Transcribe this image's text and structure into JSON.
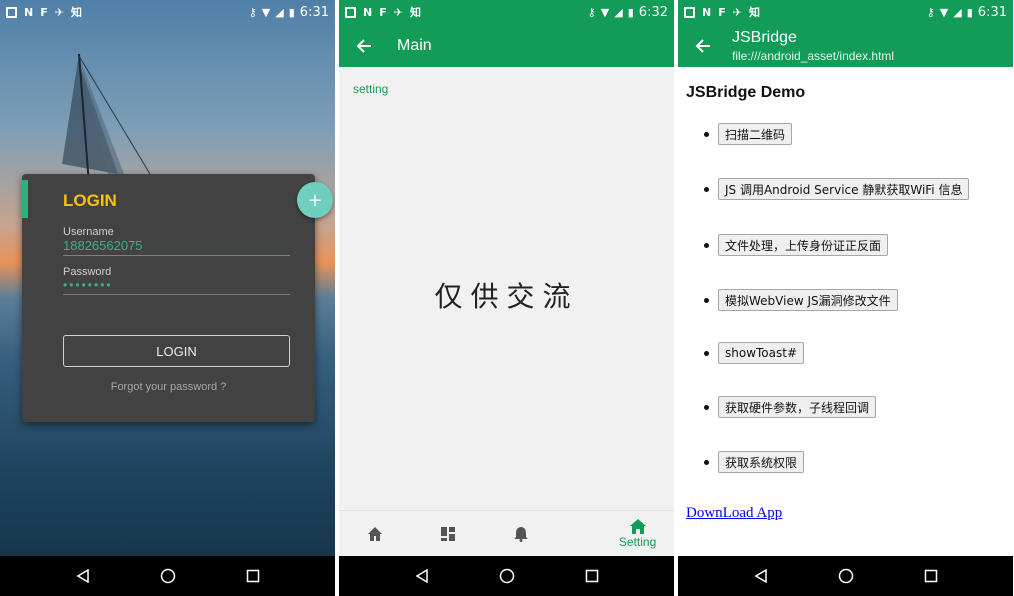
{
  "status_bars": [
    {
      "time": "6:31",
      "left_icons": [
        "notes-icon",
        "n-icon",
        "flipboard-icon",
        "twitter-icon"
      ],
      "zhi": "知"
    },
    {
      "time": "6:32",
      "left_icons": [
        "notes-icon",
        "n-icon",
        "flipboard-icon",
        "twitter-icon"
      ],
      "zhi": "知"
    },
    {
      "time": "6:31",
      "left_icons": [
        "notes-icon",
        "n-icon",
        "flipboard-icon",
        "twitter-icon"
      ],
      "zhi": "知"
    }
  ],
  "colors": {
    "brand_green": "#129c57",
    "login_yellow": "#f5c312",
    "accent_teal": "#2bb37e"
  },
  "login": {
    "title": "LOGIN",
    "username_label": "Username",
    "username_value": "18826562075",
    "password_label": "Password",
    "password_value": "••••••••",
    "button_label": "LOGIN",
    "forgot_text": "Forgot your password ?",
    "fab_icon": "plus-icon"
  },
  "main_screen": {
    "title": "Main",
    "setting_link": "setting",
    "center_text": "仅供交流",
    "tabs": [
      {
        "icon": "home-icon",
        "label": ""
      },
      {
        "icon": "dashboard-icon",
        "label": ""
      },
      {
        "icon": "bell-icon",
        "label": ""
      },
      {
        "icon": "home-icon",
        "label": "Setting",
        "active": true
      }
    ]
  },
  "jsbridge": {
    "title": "JSBridge",
    "subtitle": "file:///android_asset/index.html",
    "heading": "JSBridge Demo",
    "buttons": [
      "扫描二维码",
      "JS 调用Android Service 静默获取WiFi 信息",
      "文件处理，上传身份证正反面",
      "模拟WebView JS漏洞修改文件",
      "showToast#",
      "获取硬件参数，子线程回调",
      "获取系统权限"
    ],
    "download_link": "DownLoad App"
  }
}
